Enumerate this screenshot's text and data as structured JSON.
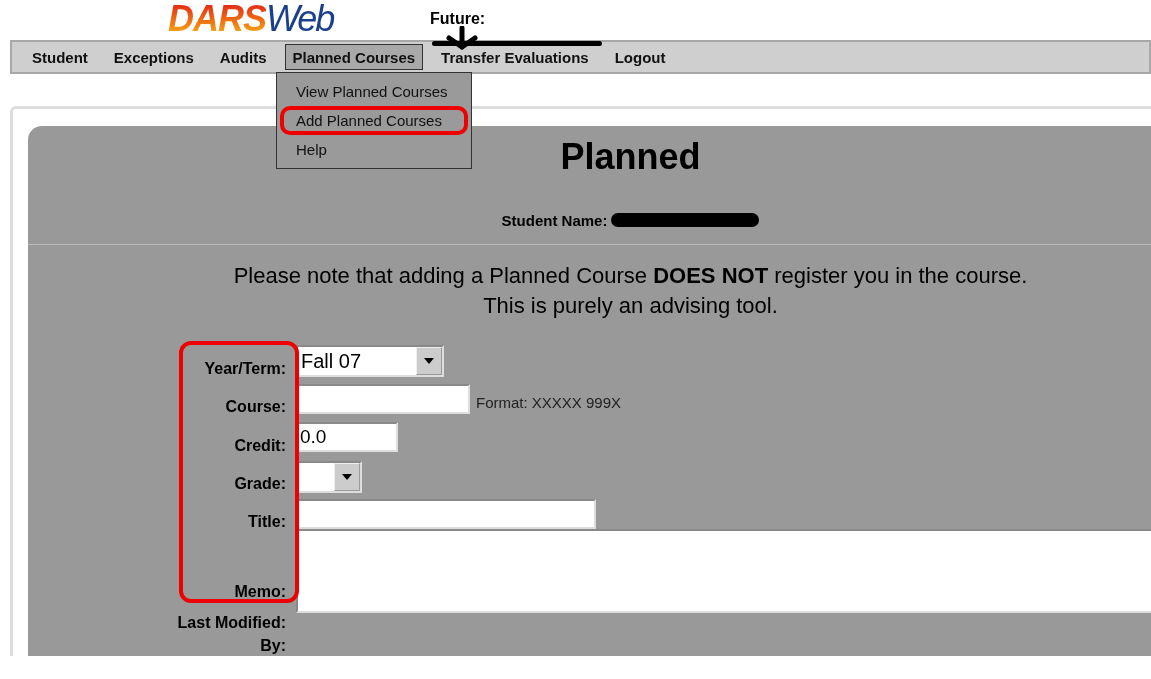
{
  "logo": {
    "bold": "DARS",
    "light": "Web"
  },
  "annotation": {
    "label": "Future:"
  },
  "nav": [
    {
      "label": "Student",
      "selected": false,
      "struck": false
    },
    {
      "label": "Exceptions",
      "selected": false,
      "struck": false
    },
    {
      "label": "Audits",
      "selected": false,
      "struck": false
    },
    {
      "label": "Planned Courses",
      "selected": true,
      "struck": false
    },
    {
      "label": "Transfer Evaluations",
      "selected": false,
      "struck": true
    },
    {
      "label": "Logout",
      "selected": false,
      "struck": false
    }
  ],
  "menu": {
    "items": [
      {
        "label": "View Planned Courses",
        "highlighted": false
      },
      {
        "label": "Add Planned Courses",
        "highlighted": true
      },
      {
        "label": "Help",
        "highlighted": false
      }
    ]
  },
  "page": {
    "title": "Planned",
    "student_label": "Student Name:",
    "name_redacted": true,
    "note": "Please note that adding a Planned Course **DOES NOT** register you in the course.",
    "note2": "This is purely an advising tool."
  },
  "form": {
    "labels_outlined": true,
    "fields": [
      {
        "kind": "select",
        "label": "Year/Term:",
        "value": "Fall 07"
      },
      {
        "kind": "text",
        "label": "Course:",
        "hint": "Format: XXXXX 999X"
      },
      {
        "kind": "credit",
        "label": "Credit:",
        "value": "0.0"
      },
      {
        "kind": "smallselect",
        "label": "Grade:"
      },
      {
        "kind": "wide",
        "label": "Title:"
      },
      {
        "kind": "memo",
        "label": "Memo:"
      }
    ],
    "last_modified": "Last Modified: By:"
  }
}
